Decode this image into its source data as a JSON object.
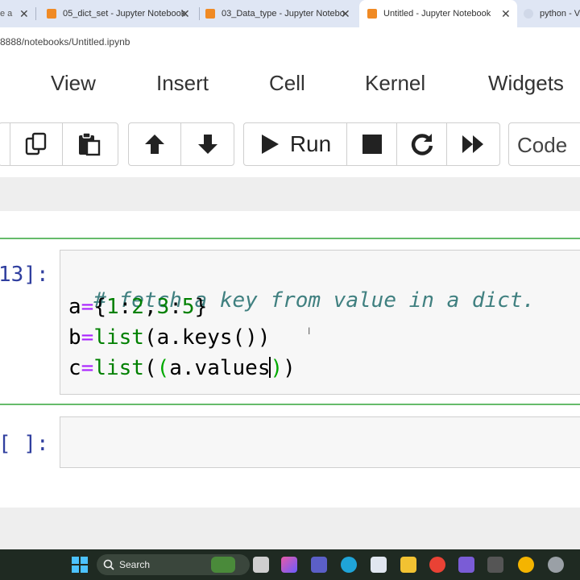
{
  "browser": {
    "tabs": [
      {
        "title": "e a"
      },
      {
        "title": "05_dict_set - Jupyter Notebook"
      },
      {
        "title": "03_Data_type - Jupyter Notebo"
      },
      {
        "title": "Untitled - Jupyter Notebook"
      },
      {
        "title": "python - Va"
      }
    ],
    "close_glyph": "✕",
    "url": "8888/notebooks/Untitled.ipynb"
  },
  "menu": {
    "items": [
      "View",
      "Insert",
      "Cell",
      "Kernel",
      "Widgets"
    ]
  },
  "toolbar": {
    "run_label": "Run",
    "cell_type": "Code"
  },
  "cells": [
    {
      "prompt": "13]:",
      "code": {
        "comment": "# fetch a key from value in a dict.",
        "line2": {
          "var": "a",
          "op": "=",
          "open": "{",
          "n1": "1",
          "c1": ":",
          "n2": "2",
          "comma": ",",
          "n3": "3",
          "c2": ":",
          "n4": "5",
          "close": "}"
        },
        "line3": {
          "var": "b",
          "op": "=",
          "fn": "list",
          "rest": "(a.keys())"
        },
        "line4": {
          "var": "c",
          "op": "=",
          "fn": "list",
          "open": "(",
          "hl_open": "(",
          "mid": "a.values",
          "hl_close": ")",
          "close": ")"
        }
      }
    },
    {
      "prompt": "[ ]:",
      "code": ""
    }
  ],
  "taskbar": {
    "search_label": "Search"
  },
  "colors": {
    "accent_green": "#66bb6a",
    "prompt_blue": "#303f9f",
    "comment_teal": "#408080",
    "operator_purple": "#aa22ff",
    "number_green": "#008000"
  }
}
